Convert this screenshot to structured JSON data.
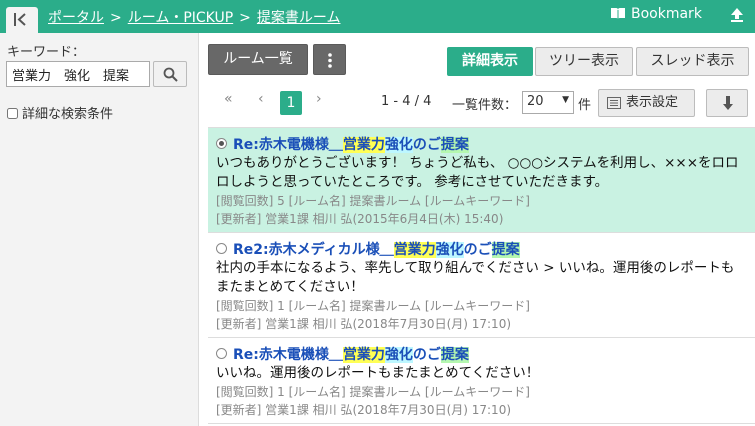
{
  "header": {
    "breadcrumb": [
      "ポータル",
      "ルーム・PICKUP",
      "提案書ルーム"
    ],
    "separator": ">",
    "bookmark_label": "Bookmark"
  },
  "sidebar": {
    "keyword_label": "キーワード：",
    "search_value": "営業力　強化　提案",
    "advanced_search_label": "詳細な検索条件"
  },
  "toolbar": {
    "room_list_label": "ルーム一覧",
    "view_tabs": [
      "詳細表示",
      "ツリー表示",
      "スレッド表示"
    ],
    "active_tab": "詳細表示"
  },
  "pager": {
    "first": "«",
    "prev": "‹",
    "current_page": "1",
    "next": "›",
    "range": "1 - 4 / 4",
    "page_size_label": "一覧件数：",
    "page_size": "20",
    "page_size_unit": "件",
    "display_settings_label": "表示設定"
  },
  "posts": [
    {
      "title_prefix": "Re:赤木電機様＿",
      "hl1": "営業力",
      "hl2": "強化",
      "mid": "のご",
      "hl3": "提案",
      "body": "いつもありがとうございます！ ちょうど私も、 ○○○システムを利用し、×××をロロロしようと思っていたところです。 参考にさせていただきます。",
      "meta1": "[閲覧回数] 5 [ルーム名] 提案書ルーム [ルームキーワード]",
      "meta2": "[更新者] 営業1課 相川 弘(2015年6月4日(木) 15:40)"
    },
    {
      "title_prefix": "Re2:赤木メディカル様＿",
      "hl1": "営業力",
      "hl2": "強化",
      "mid": "のご",
      "hl3": "提案",
      "body": "社内の手本になるよう、率先して取り組んでください > いいね。運用後のレポートもまたまとめてください！",
      "meta1": "[閲覧回数] 1 [ルーム名] 提案書ルーム [ルームキーワード]",
      "meta2": "[更新者] 営業1課 相川 弘(2018年7月30日(月) 17:10)"
    },
    {
      "title_prefix": "Re:赤木電機様＿",
      "hl1": "営業力",
      "hl2": "強化",
      "mid": "のご",
      "hl3": "提案",
      "body": "いいね。運用後のレポートもまたまとめてください！",
      "meta1": "[閲覧回数] 1 [ルーム名] 提案書ルーム [ルームキーワード]",
      "meta2": "[更新者] 営業1課 相川 弘(2018年7月30日(月) 17:10)"
    }
  ],
  "colors": {
    "accent": "#2bad8a",
    "active_row": "#c9f2e2",
    "link": "#1a4fb8"
  }
}
